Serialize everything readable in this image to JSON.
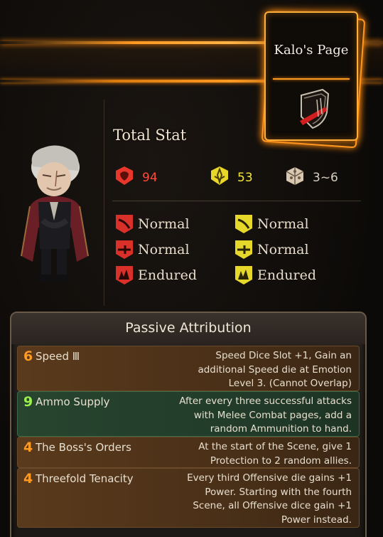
{
  "page_card": {
    "title": "Kalo's Page"
  },
  "stats": {
    "heading": "Total Stat",
    "hp": "94",
    "stagger": "53",
    "speed": "3~6"
  },
  "resistances": {
    "hp": [
      {
        "label": "Normal",
        "icon": "slash-resist-icon"
      },
      {
        "label": "Normal",
        "icon": "pierce-resist-icon"
      },
      {
        "label": "Endured",
        "icon": "blunt-resist-icon"
      }
    ],
    "stagger": [
      {
        "label": "Normal",
        "icon": "slash-resist-icon"
      },
      {
        "label": "Normal",
        "icon": "pierce-resist-icon"
      },
      {
        "label": "Endured",
        "icon": "blunt-resist-icon"
      }
    ]
  },
  "passive": {
    "title": "Passive Attribution",
    "items": [
      {
        "cost": "6",
        "name": "Speed Ⅲ",
        "desc_lines": [
          "Speed Dice Slot +1, Gain an",
          "additional Speed die at Emotion",
          "Level 3. (Cannot Overlap)"
        ]
      },
      {
        "cost": "9",
        "name": "Ammo Supply",
        "desc_lines": [
          "After every three successful attacks",
          "with Melee Combat pages, add a",
          "random Ammunition to hand."
        ]
      },
      {
        "cost": "4",
        "name": "The Boss's Orders",
        "desc_lines": [
          "At the start of the Scene, give 1",
          "Protection to 2 random allies."
        ]
      },
      {
        "cost": "4",
        "name": "Threefold Tenacity",
        "desc_lines": [
          "Every third Offensive die gains +1",
          "Power. Starting with the fourth",
          "Scene, all Offensive dice gain +1",
          "Power instead."
        ]
      }
    ]
  },
  "colors": {
    "accent": "#ff9a22",
    "hp": "#ff4a3a",
    "stagger": "#f5e63a",
    "highlight_row": "#27452f"
  }
}
